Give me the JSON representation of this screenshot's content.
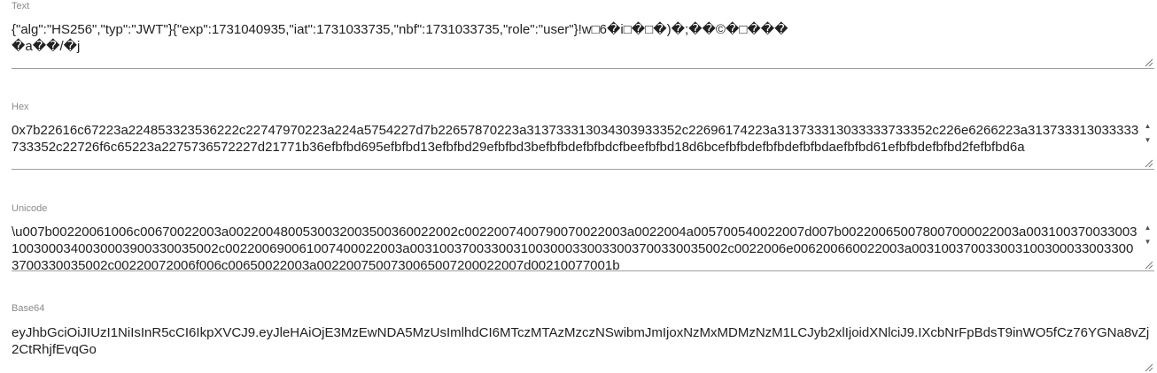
{
  "text": {
    "label": "Text",
    "value": "{\"alg\":\"HS256\",\"typ\":\"JWT\"}{\"exp\":1731040935,\"iat\":1731033735,\"nbf\":1731033735,\"role\":\"user\"}!w□6�i□�□�)�;��©�□���\n�a��/�j"
  },
  "hex": {
    "label": "Hex",
    "value": "0x7b22616c67223a224853323536222c22747970223a224a5754227d7b22657870223a313733313034303933352c22696174223a313733313033333733352c226e6266223a313733313033333733352c22726f6c65223a2275736572227d21771b36efbfbd695efbfbd13efbfbd29efbfbd3befbfbdefbfbdcfbeefbfbd18d6bcefbfbdefbfbdefbfbdaefbfbd61efbfbdefbfbd2fefbfbd6a"
  },
  "unicode": {
    "label": "Unicode",
    "value": "\\u007b00220061006c00670022003a0022004800530032003500360022002c0022007400790070022003a0022004a005700540022007d007b002200650078007000022003a0031003700330031003000340030003900330035002c002200690061007400022003a0031003700330031003000330033003700330035002c0022006e006200660022003a0031003700330031003000330033003700330035002c00220072006f006c00650022003a0022007500730065007200022007d00210077001b"
  },
  "base64": {
    "label": "Base64",
    "value": "eyJhbGciOiJIUzI1NiIsInR5cCI6IkpXVCJ9.eyJleHAiOjE3MzEwNDA5MzUsImlhdCI6MTczMTAzMzczNSwibmJmIjoxNzMxMDMzNzM1LCJyb2xlIjoidXNlciJ9.IXcbNrFpBdsT9inWO5fCz76YGNa8vZj2CtRhjfEvqGo"
  },
  "icons": {
    "resize": "resize-grip-icon",
    "scroll_up": "scroll-up-arrow-icon",
    "scroll_down": "scroll-down-arrow-icon"
  }
}
